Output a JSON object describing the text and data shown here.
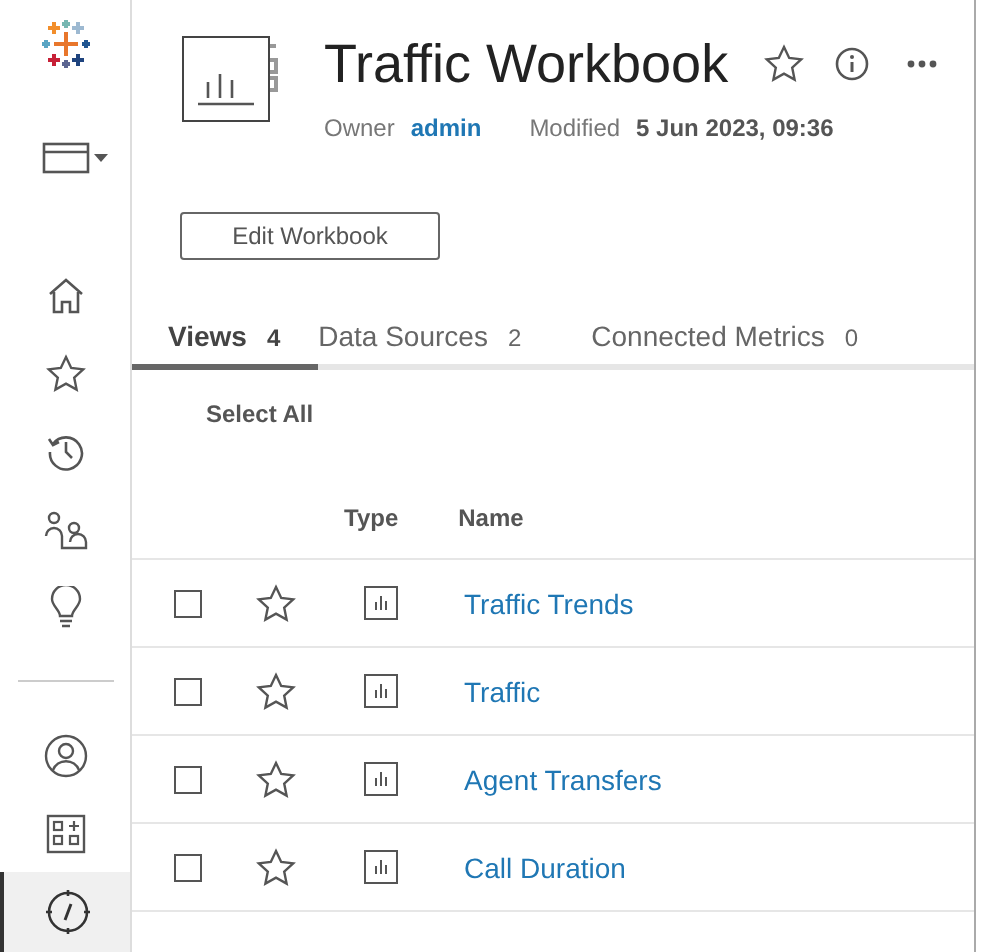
{
  "sidebar": {
    "items": [
      {
        "selected": false
      },
      {
        "selected": false
      },
      {
        "selected": false
      },
      {
        "selected": false
      },
      {
        "selected": false
      },
      {
        "selected": false
      },
      {
        "selected": false
      },
      {
        "selected": false
      },
      {
        "selected": false
      },
      {
        "selected": true
      }
    ]
  },
  "workbook": {
    "title": "Traffic Workbook",
    "owner_label": "Owner",
    "owner": "admin",
    "modified_label": "Modified",
    "modified": "5 Jun 2023, 09:36",
    "favorite": false
  },
  "edit_button": "Edit Workbook",
  "tabs": [
    {
      "label": "Views",
      "count": "4",
      "selected": true
    },
    {
      "label": "Data Sources",
      "count": "2",
      "selected": false
    },
    {
      "label": "Connected Metrics",
      "count": "0",
      "selected": false
    }
  ],
  "select_all": "Select All",
  "table": {
    "columns": [
      "Type",
      "Name"
    ],
    "rows": [
      {
        "name": "Traffic Trends",
        "checked": false,
        "favorite": false
      },
      {
        "name": "Traffic",
        "checked": false,
        "favorite": false
      },
      {
        "name": "Agent Transfers",
        "checked": false,
        "favorite": false
      },
      {
        "name": "Call Duration",
        "checked": false,
        "favorite": false
      }
    ]
  }
}
